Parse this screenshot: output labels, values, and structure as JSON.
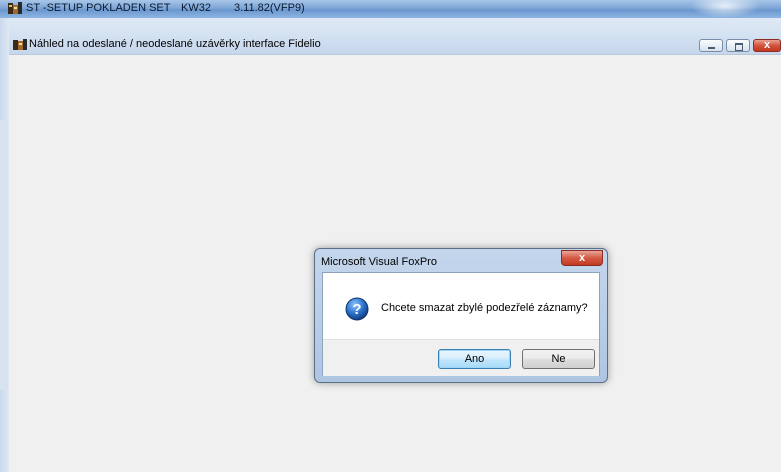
{
  "app": {
    "title_name": "ST -SETUP POKLADEN SET",
    "title_station": "KW32",
    "title_version": "3.11.82(VFP9)"
  },
  "child_window": {
    "title": "Náhled na odeslané / neodeslané uzávěrky interface Fidelio",
    "controls": {
      "minimize": "minimize",
      "maximize": "maximize",
      "close": "x"
    }
  },
  "dialog": {
    "title": "Microsoft Visual FoxPro",
    "close_glyph": "x",
    "icon": "question-icon",
    "message": "Chcete smazat zbylé podezřelé záznamy?",
    "buttons": {
      "yes": "Ano",
      "no": "Ne"
    }
  },
  "colors": {
    "titlebar": "#7ea6d6",
    "close_button": "#c4361f",
    "question_icon": "#1d5fb5",
    "default_button_border": "#3c7fb1"
  }
}
